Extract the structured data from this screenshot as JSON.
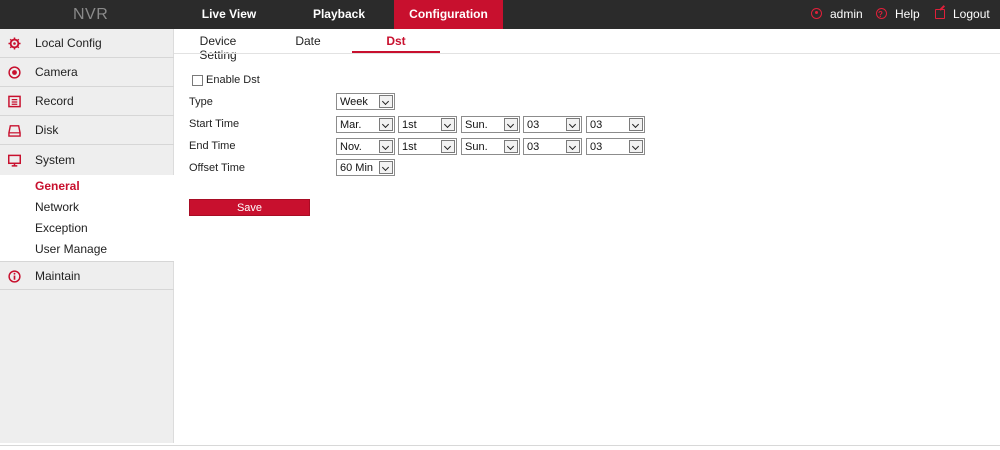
{
  "header": {
    "logo": "NVR",
    "nav": [
      "Live View",
      "Playback",
      "Configuration"
    ],
    "active_nav": "Configuration",
    "user": "admin",
    "help": "Help",
    "logout": "Logout",
    "accent_color": "#c8102e"
  },
  "sidebar": {
    "items": [
      {
        "label": "Local Config",
        "icon": "gear-icon"
      },
      {
        "label": "Camera",
        "icon": "camera-icon"
      },
      {
        "label": "Record",
        "icon": "record-icon"
      },
      {
        "label": "Disk",
        "icon": "disk-icon"
      },
      {
        "label": "System",
        "icon": "monitor-icon"
      },
      {
        "label": "Maintain",
        "icon": "info-icon"
      }
    ],
    "system_sub": [
      "General",
      "Network",
      "Exception",
      "User Manage"
    ],
    "active_sub": "General"
  },
  "tabs": [
    "Device Setting",
    "Date",
    "Dst"
  ],
  "active_tab": "Dst",
  "form": {
    "enable_label": "Enable Dst",
    "enable_checked": false,
    "type_label": "Type",
    "type_value": "Week",
    "start_label": "Start Time",
    "start": [
      "Mar.",
      "1st",
      "Sun.",
      "03",
      "03"
    ],
    "end_label": "End Time",
    "end": [
      "Nov.",
      "1st",
      "Sun.",
      "03",
      "03"
    ],
    "offset_label": "Offset Time",
    "offset_value": "60 Min",
    "save_label": "Save"
  }
}
